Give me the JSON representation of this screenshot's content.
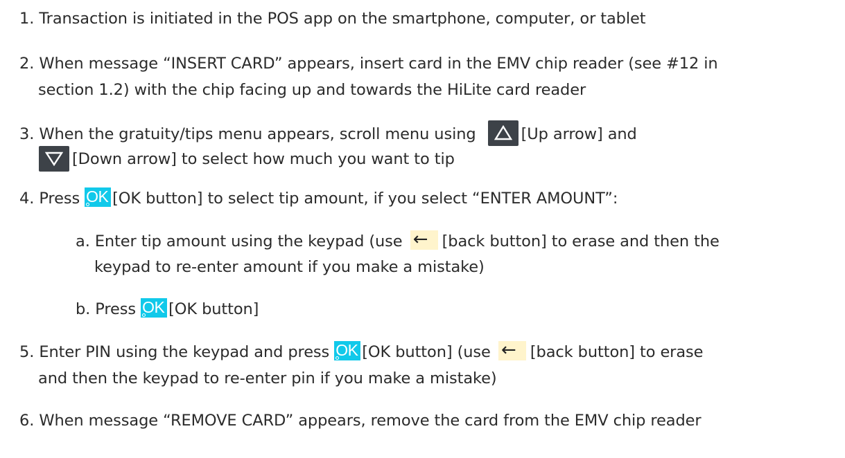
{
  "steps": {
    "s1": {
      "num": "1.",
      "text": "Transaction is initiated in the POS app on the smartphone, computer, or tablet"
    },
    "s2": {
      "num": "2.",
      "line1": "When message “INSERT CARD” appears, insert card in the EMV chip reader (see #12 in",
      "line2": "section 1.2)  with the chip facing up and towards the HiLite card reader"
    },
    "s3": {
      "num": "3.",
      "pre": "When the gratuity/tips menu appears, scroll menu using",
      "up_label": "[Up arrow] and",
      "down_label": "[Down arrow] to select how much you want to tip"
    },
    "s4": {
      "num": "4.",
      "pre": "Press",
      "post": "[OK button] to select tip amount, if you select “ENTER AMOUNT”:",
      "a": {
        "num": "a.",
        "pre": "Enter tip amount using the keypad (use",
        "post": "[back button] to erase and then the",
        "line2": "keypad to re-enter amount if you make a mistake)"
      },
      "b": {
        "num": "b.",
        "pre": "Press",
        "post": "[OK button]"
      }
    },
    "s5": {
      "num": "5.",
      "pre": "Enter PIN using the keypad and press",
      "mid": "[OK button] (use",
      "post": "[back button] to erase",
      "line2": "and then the keypad to re-enter pin if you make a mistake)"
    },
    "s6": {
      "num": "6.",
      "text": "When message “REMOVE CARD” appears, remove the card from the EMV chip reader"
    }
  },
  "keys": {
    "ok_label": "OK",
    "back_symbol": "←",
    "up_icon": "up-triangle-icon",
    "down_icon": "down-triangle-icon"
  },
  "colors": {
    "text": "#2b2b2b",
    "ok_key": "#11c9ea",
    "arrow_key": "#3d4248",
    "back_key": "#fff4cc"
  }
}
